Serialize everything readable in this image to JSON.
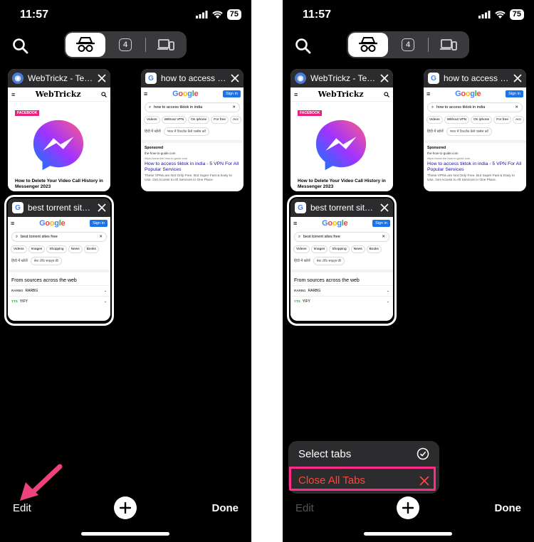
{
  "status": {
    "time": "11:57",
    "battery": "75"
  },
  "tab_switcher": {
    "tab_count": "4"
  },
  "tabs": [
    {
      "title": "WebTrickz - Tec...",
      "favicon": "globe-icon"
    },
    {
      "title": "how to access t...",
      "favicon": "google-g-icon"
    },
    {
      "title": "best torrent site...",
      "favicon": "google-g-icon"
    }
  ],
  "webtrickz_page": {
    "logo": "WebTrickz",
    "badge": "FACEBOOK",
    "headline": "How to Delete Your Video Call History in Messenger 2023"
  },
  "google_page_1": {
    "logo_parts": [
      "G",
      "o",
      "o",
      "g",
      "l",
      "e"
    ],
    "sign_in": "Sign in",
    "query": "how to access tiktok in india",
    "chips": [
      "Videos",
      "Without VPN",
      "On iphone",
      "For free",
      "Acc"
    ],
    "hindi_label": "हिंदी में खोजें",
    "hindi_chip": "भारत में टिकटॉक कैसे एक्सेस करें",
    "sponsored": "Sponsored",
    "ad_site": "the-how-to-guide.com",
    "ad_url": "https://www.the-how-to-guide.com",
    "ad_link": "How to access tiktok in india - 5 VPN For All Popular Services",
    "ad_desc": "These VPNs are Not Only Free, But Super Fast & Easy to Use. Get Access to All Services in One Place."
  },
  "google_page_2": {
    "sign_in": "Sign in",
    "query": "best torrent sites free",
    "chips": [
      "Videos",
      "Images",
      "Shopping",
      "News",
      "Books"
    ],
    "hindi_label": "हिंदी में खोजें",
    "hindi_chip": "बेस्ट टोरेंट साइट्स फ्री",
    "sources_title": "From sources across the web",
    "sources": [
      {
        "logo": "RARBG",
        "name": "RARBG"
      },
      {
        "logo": "YTS",
        "name": "YIFY"
      }
    ]
  },
  "bottom_bar": {
    "edit": "Edit",
    "done": "Done"
  },
  "menu": {
    "select_tabs": "Select tabs",
    "close_all": "Close All Tabs"
  },
  "colors": {
    "danger": "#ff453a",
    "highlight": "#ff2d87",
    "arrow": "#f0417f"
  }
}
